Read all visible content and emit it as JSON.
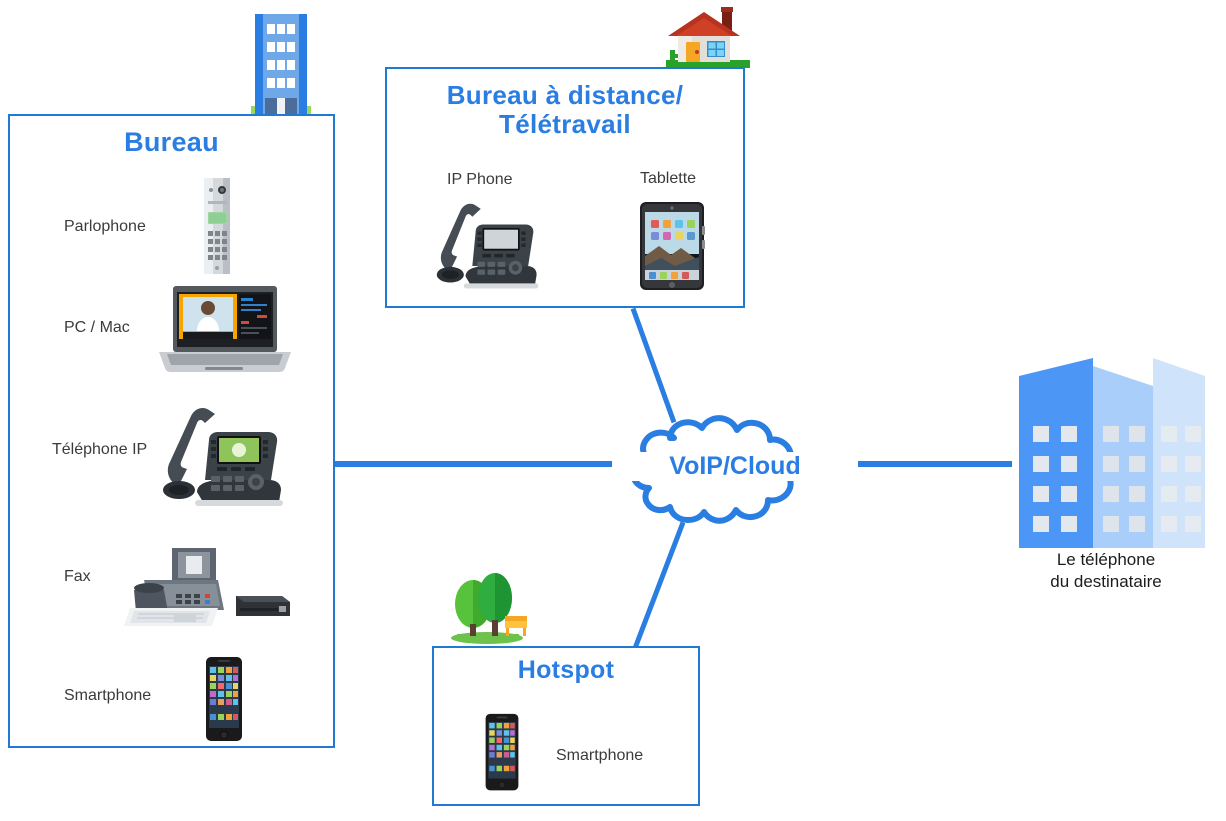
{
  "diagram": {
    "title": "VoIP / Cloud telephony topology",
    "accent_color": "#2a7de1",
    "border_color": "#2079d2",
    "label_color": "#3b3b3b"
  },
  "office_box": {
    "title": "Bureau",
    "building_icon": "office-building-icon",
    "devices": [
      {
        "label": "Parlophone",
        "icon": "door-intercom-icon"
      },
      {
        "label": "PC / Mac",
        "icon": "laptop-icon"
      },
      {
        "label": "Téléphone IP",
        "icon": "desk-ip-phone-icon"
      },
      {
        "label": "Fax",
        "icon": "fax-machine-icon"
      },
      {
        "label": "Smartphone",
        "icon": "smartphone-icon"
      }
    ]
  },
  "remote_box": {
    "title_line1": "Bureau à distance/",
    "title_line2": "Télétravail",
    "house_icon": "house-icon",
    "devices": [
      {
        "label": "IP Phone",
        "icon": "desk-ip-phone-icon"
      },
      {
        "label": "Tablette",
        "icon": "tablet-icon"
      }
    ]
  },
  "hotspot_box": {
    "title": "Hotspot",
    "park_icon": "park-trees-bench-icon",
    "devices": [
      {
        "label": "Smartphone",
        "icon": "smartphone-icon"
      }
    ]
  },
  "cloud": {
    "label": "VoIP/Cloud",
    "icon": "cloud-icon"
  },
  "destination": {
    "icon": "office-buildings-icon",
    "caption_line1": "Le téléphone",
    "caption_line2": "du destinataire"
  }
}
